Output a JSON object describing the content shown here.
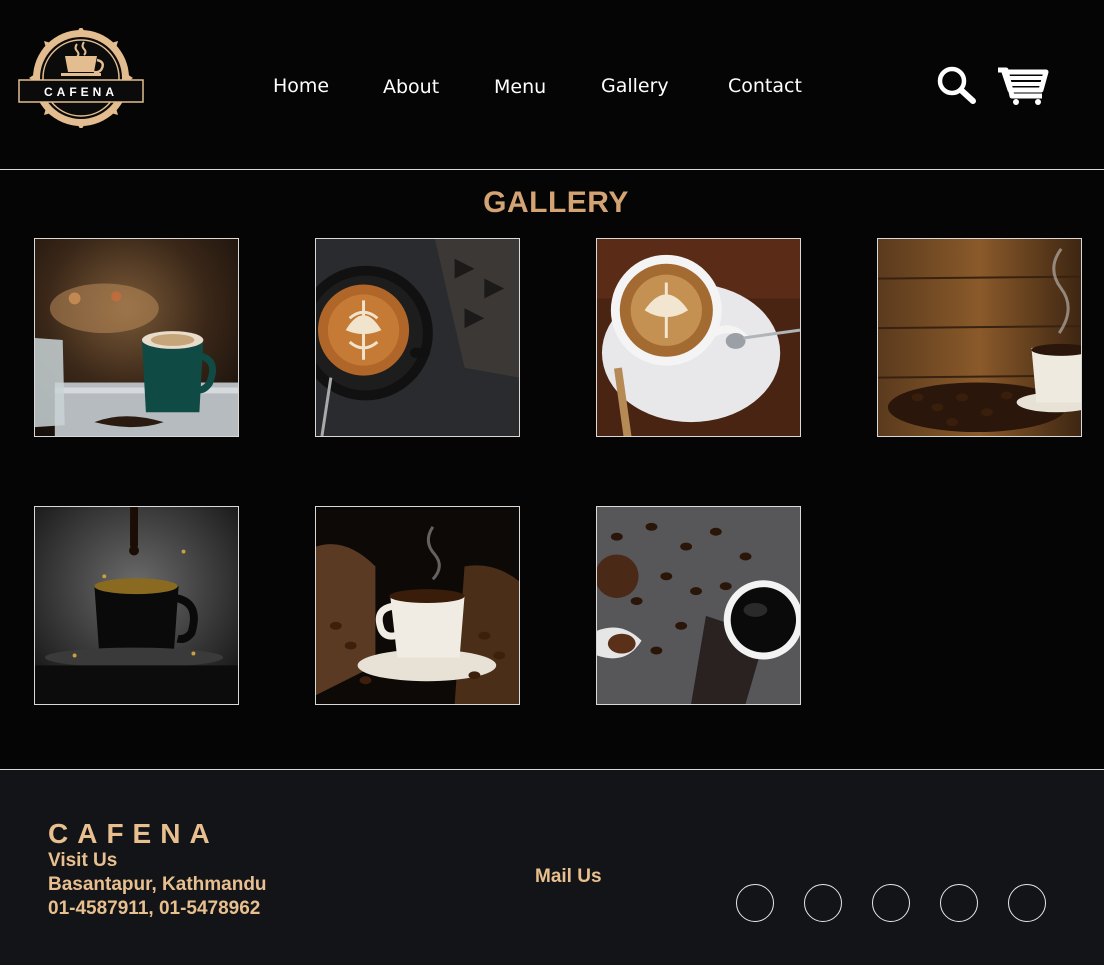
{
  "brand": {
    "logo_text": "CAFENA",
    "logo_alt": "Cafena coffee cup logo"
  },
  "nav": {
    "items": [
      {
        "label": "Home"
      },
      {
        "label": "About"
      },
      {
        "label": "Menu"
      },
      {
        "label": "Gallery"
      },
      {
        "label": "Contact"
      }
    ],
    "search_icon": "search-icon",
    "cart_icon": "cart-icon"
  },
  "gallery": {
    "title": "GALLERY",
    "images": [
      {
        "name": "latte-art-green-cup"
      },
      {
        "name": "latte-art-top-view"
      },
      {
        "name": "cappuccino-white-cup"
      },
      {
        "name": "steaming-coffee-beans-wood"
      },
      {
        "name": "coffee-splash-black-cup"
      },
      {
        "name": "coffee-cup-beans-burlap"
      },
      {
        "name": "black-coffee-beans-grounds"
      }
    ]
  },
  "footer": {
    "brand": "CAFENA",
    "visit_label": "Visit Us",
    "address": "Basantapur, Kathmandu",
    "phones": "01-4587911, 01-5478962",
    "mail_label": "Mail Us",
    "social_count": 5
  },
  "colors": {
    "background": "#050505",
    "accent": "#d4a373",
    "footer_bg": "#131418",
    "footer_text": "#e8bf8e"
  }
}
